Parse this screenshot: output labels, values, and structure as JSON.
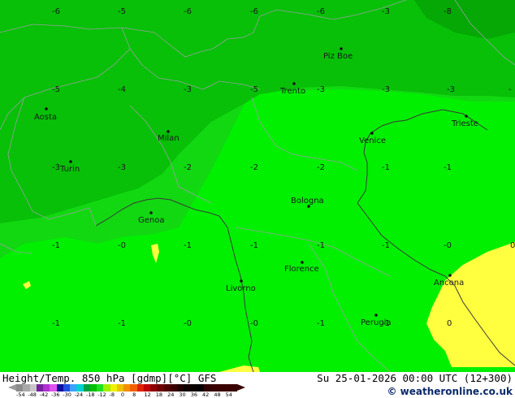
{
  "map": {
    "colors": {
      "field_main": "#12d812",
      "field_light": "#00f000",
      "field_dark": "#07c007",
      "field_darker": "#05a805",
      "field_yellow": "#ffff40",
      "coast": "#3a3a3a",
      "border": "#9aa0a0"
    },
    "value_labels": [
      {
        "text": "-6"
      },
      {
        "text": "-5"
      },
      {
        "text": "-6"
      },
      {
        "text": "-6"
      },
      {
        "text": "-6"
      },
      {
        "text": "-3"
      },
      {
        "text": "-8"
      },
      {
        "text": "-5"
      },
      {
        "text": "-4"
      },
      {
        "text": "-3"
      },
      {
        "text": "-5"
      },
      {
        "text": "-3"
      },
      {
        "text": "-3"
      },
      {
        "text": "-3"
      },
      {
        "text": "-"
      },
      {
        "text": "-3"
      },
      {
        "text": "-3"
      },
      {
        "text": "-2"
      },
      {
        "text": "-2"
      },
      {
        "text": "-2"
      },
      {
        "text": "-1"
      },
      {
        "text": "-1"
      },
      {
        "text": "-1"
      },
      {
        "text": "-0"
      },
      {
        "text": "-1"
      },
      {
        "text": "-1"
      },
      {
        "text": "-1"
      },
      {
        "text": "-1"
      },
      {
        "text": "-0"
      },
      {
        "text": "0"
      },
      {
        "text": "-1"
      },
      {
        "text": "-1"
      },
      {
        "text": "-0"
      },
      {
        "text": "-0"
      },
      {
        "text": "-1"
      },
      {
        "text": "-1"
      },
      {
        "text": "0"
      }
    ],
    "cities": [
      {
        "name": "Aosta"
      },
      {
        "name": "Milan"
      },
      {
        "name": "Turin"
      },
      {
        "name": "Trento"
      },
      {
        "name": "Piz Boe"
      },
      {
        "name": "Venice"
      },
      {
        "name": "Trieste"
      },
      {
        "name": "Bologna"
      },
      {
        "name": "Genoa"
      },
      {
        "name": "Florence"
      },
      {
        "name": "Livorno"
      },
      {
        "name": "Ancona"
      },
      {
        "name": "Perugia"
      }
    ]
  },
  "footer": {
    "title": "Height/Temp. 850 hPa [gdmp][°C] GFS",
    "datetime": "Su 25-01-2026 00:00 UTC (12+300)",
    "credit": "© weatheronline.co.uk",
    "legend_ticks": [
      "-54",
      "-48",
      "-42",
      "-36",
      "-30",
      "-24",
      "-18",
      "-12",
      "-8",
      "0",
      "8",
      "12",
      "18",
      "24",
      "30",
      "36",
      "42",
      "48",
      "54"
    ],
    "legend_colors": [
      "#8c8c8c",
      "#a8a8a8",
      "#c8c8c8",
      "#7a1fa0",
      "#b030d0",
      "#e050f0",
      "#1010a0",
      "#2050e0",
      "#40a0ff",
      "#00d0d0",
      "#00a040",
      "#00c000",
      "#20e020",
      "#a0f000",
      "#f0f000",
      "#f0c000",
      "#f09000",
      "#f06000",
      "#e02000",
      "#c00000",
      "#900000",
      "#700000",
      "#500000",
      "#3a0000",
      "#200000",
      "#100000",
      "#0a0000",
      "#050000",
      "#300000",
      "#3a0000",
      "#3a0000",
      "#3a0000",
      "#3a0000"
    ]
  }
}
